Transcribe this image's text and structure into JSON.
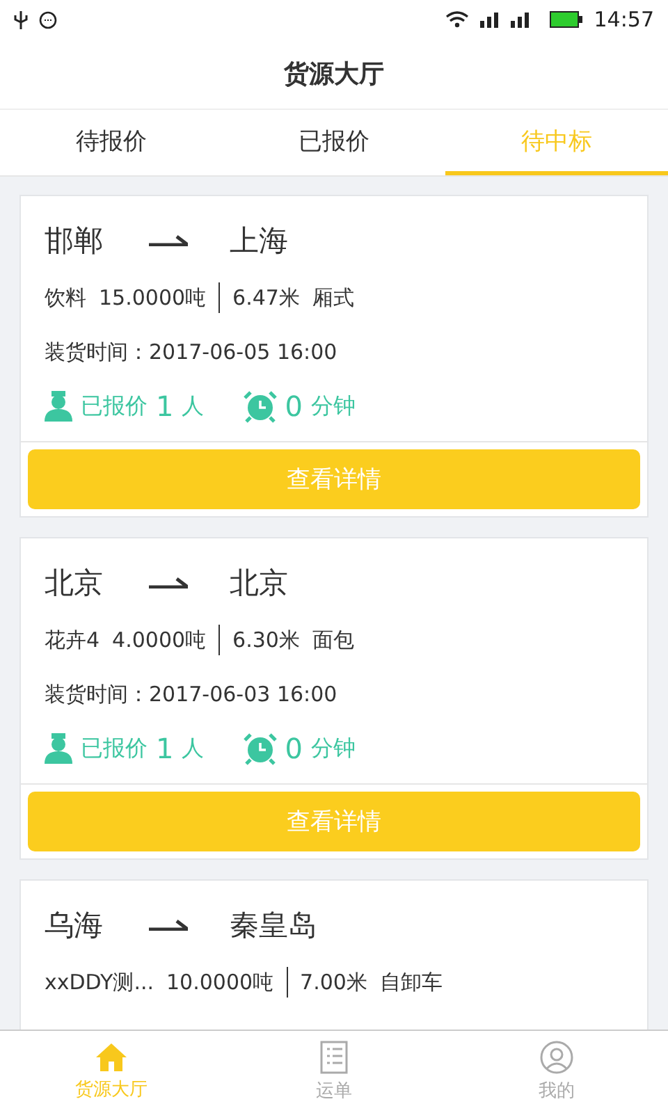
{
  "status_bar": {
    "time": "14:57"
  },
  "header": {
    "title": "货源大厅"
  },
  "tabs": [
    {
      "label": "待报价",
      "selected": false
    },
    {
      "label": "已报价",
      "selected": false
    },
    {
      "label": "待中标",
      "selected": true
    }
  ],
  "cards": [
    {
      "from": "邯郸",
      "to": "上海",
      "cargo": "饮料",
      "weight": "15.0000吨",
      "length": "6.47米",
      "truck": "厢式",
      "load_time": "装货时间：2017-06-05 16:00",
      "quoted_label": "已报价",
      "quoted_count": "1",
      "quoted_unit": "人",
      "minutes": "0",
      "minutes_unit": "分钟",
      "button": "查看详情"
    },
    {
      "from": "北京",
      "to": "北京",
      "cargo": "花卉4",
      "weight": "4.0000吨",
      "length": "6.30米",
      "truck": "面包",
      "load_time": "装货时间：2017-06-03 16:00",
      "quoted_label": "已报价",
      "quoted_count": "1",
      "quoted_unit": "人",
      "minutes": "0",
      "minutes_unit": "分钟",
      "button": "查看详情"
    },
    {
      "from": "乌海",
      "to": "秦皇岛",
      "cargo": "xxDDY测...",
      "weight": "10.0000吨",
      "length": "7.00米",
      "truck": "自卸车"
    }
  ],
  "bottom_nav": [
    {
      "label": "货源大厅",
      "kind": "home",
      "selected": true
    },
    {
      "label": "运单",
      "kind": "list",
      "selected": false
    },
    {
      "label": "我的",
      "kind": "person",
      "selected": false
    }
  ]
}
